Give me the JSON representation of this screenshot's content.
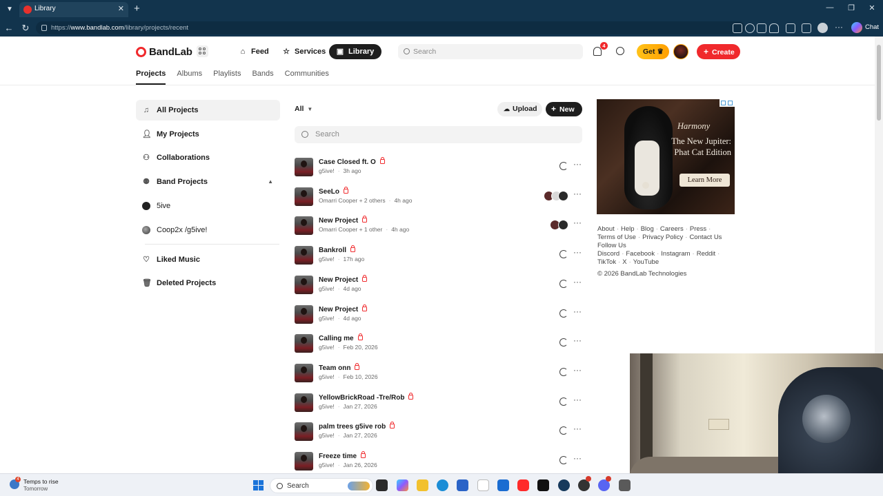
{
  "browser": {
    "tab_title": "Library",
    "url_scheme": "https://",
    "url_host": "www.bandlab.com",
    "url_path": "/library/projects/recent",
    "copilot_label": "Chat",
    "new_tab_icon": "plus-icon",
    "close_tab_icon": "close-icon"
  },
  "header": {
    "logo_text": "BandLab",
    "nav": [
      {
        "label": "Feed",
        "icon": "home-icon"
      },
      {
        "label": "Services",
        "icon": "star-icon"
      },
      {
        "label": "Library",
        "icon": "library-icon",
        "active": true
      }
    ],
    "search_placeholder": "Search",
    "notifications_count": "4",
    "get_label": "Get",
    "create_label": "Create"
  },
  "subtabs": [
    "Projects",
    "Albums",
    "Playlists",
    "Bands",
    "Communities"
  ],
  "sidebar": {
    "items": [
      {
        "label": "All Projects",
        "icon": "music-note-icon"
      },
      {
        "label": "My Projects",
        "icon": "user-icon"
      },
      {
        "label": "Collaborations",
        "icon": "users-icon"
      },
      {
        "label": "Band Projects",
        "icon": "band-icon"
      },
      {
        "label": "5ive"
      },
      {
        "label": "Coop2x /g5ive!"
      },
      {
        "label": "Liked Music",
        "icon": "heart-icon"
      },
      {
        "label": "Deleted Projects",
        "icon": "trash-icon"
      }
    ]
  },
  "main": {
    "filter_label": "All",
    "upload_label": "Upload",
    "new_label": "New",
    "search_placeholder": "Search",
    "projects": [
      {
        "title": "Case Closed ft. O",
        "owner": "g5ive!",
        "time": "3h ago"
      },
      {
        "title": "SeeLo",
        "owner": "Omarri Cooper + 2 others",
        "time": "4h ago"
      },
      {
        "title": "New Project",
        "owner": "Omarri Cooper + 1 other",
        "time": "4h ago"
      },
      {
        "title": "Bankroll",
        "owner": "g5ive!",
        "time": "17h ago"
      },
      {
        "title": "New Project",
        "owner": "g5ive!",
        "time": "4d ago"
      },
      {
        "title": "New Project",
        "owner": "g5ive!",
        "time": "4d ago"
      },
      {
        "title": "Calling me",
        "owner": "g5ive!",
        "time": "Feb 20, 2026"
      },
      {
        "title": "Team onn",
        "owner": "g5ive!",
        "time": "Feb 10, 2026"
      },
      {
        "title": "YellowBrickRoad -Tre/Rob",
        "owner": "g5ive!",
        "time": "Jan 27, 2026"
      },
      {
        "title": "palm trees g5ive rob",
        "owner": "g5ive!",
        "time": "Jan 27, 2026"
      },
      {
        "title": "Freeze time",
        "owner": "g5ive!",
        "time": "Jan 26, 2026"
      }
    ]
  },
  "ad": {
    "brand": "Harmony",
    "headline": "The New Jupiter: Phat Cat Edition",
    "cta": "Learn More"
  },
  "footer": {
    "links_row1": [
      "About",
      "Help",
      "Blog",
      "Careers",
      "Press"
    ],
    "links_row2": [
      "Terms of Use",
      "Privacy Policy",
      "Contact Us"
    ],
    "follow_label": "Follow Us",
    "social_row1": [
      "Discord",
      "Facebook",
      "Instagram",
      "Reddit"
    ],
    "social_row2": [
      "TikTok",
      "X",
      "YouTube"
    ],
    "copyright": "© 2026 BandLab Technologies"
  },
  "taskbar": {
    "weather_title": "Temps to rise",
    "weather_sub": "Tomorrow",
    "weather_badge": "4",
    "search_placeholder": "Search"
  },
  "colors": {
    "brand_red": "#f0292c",
    "chrome_dark": "#12344d",
    "get_gold": "#ffb000"
  }
}
